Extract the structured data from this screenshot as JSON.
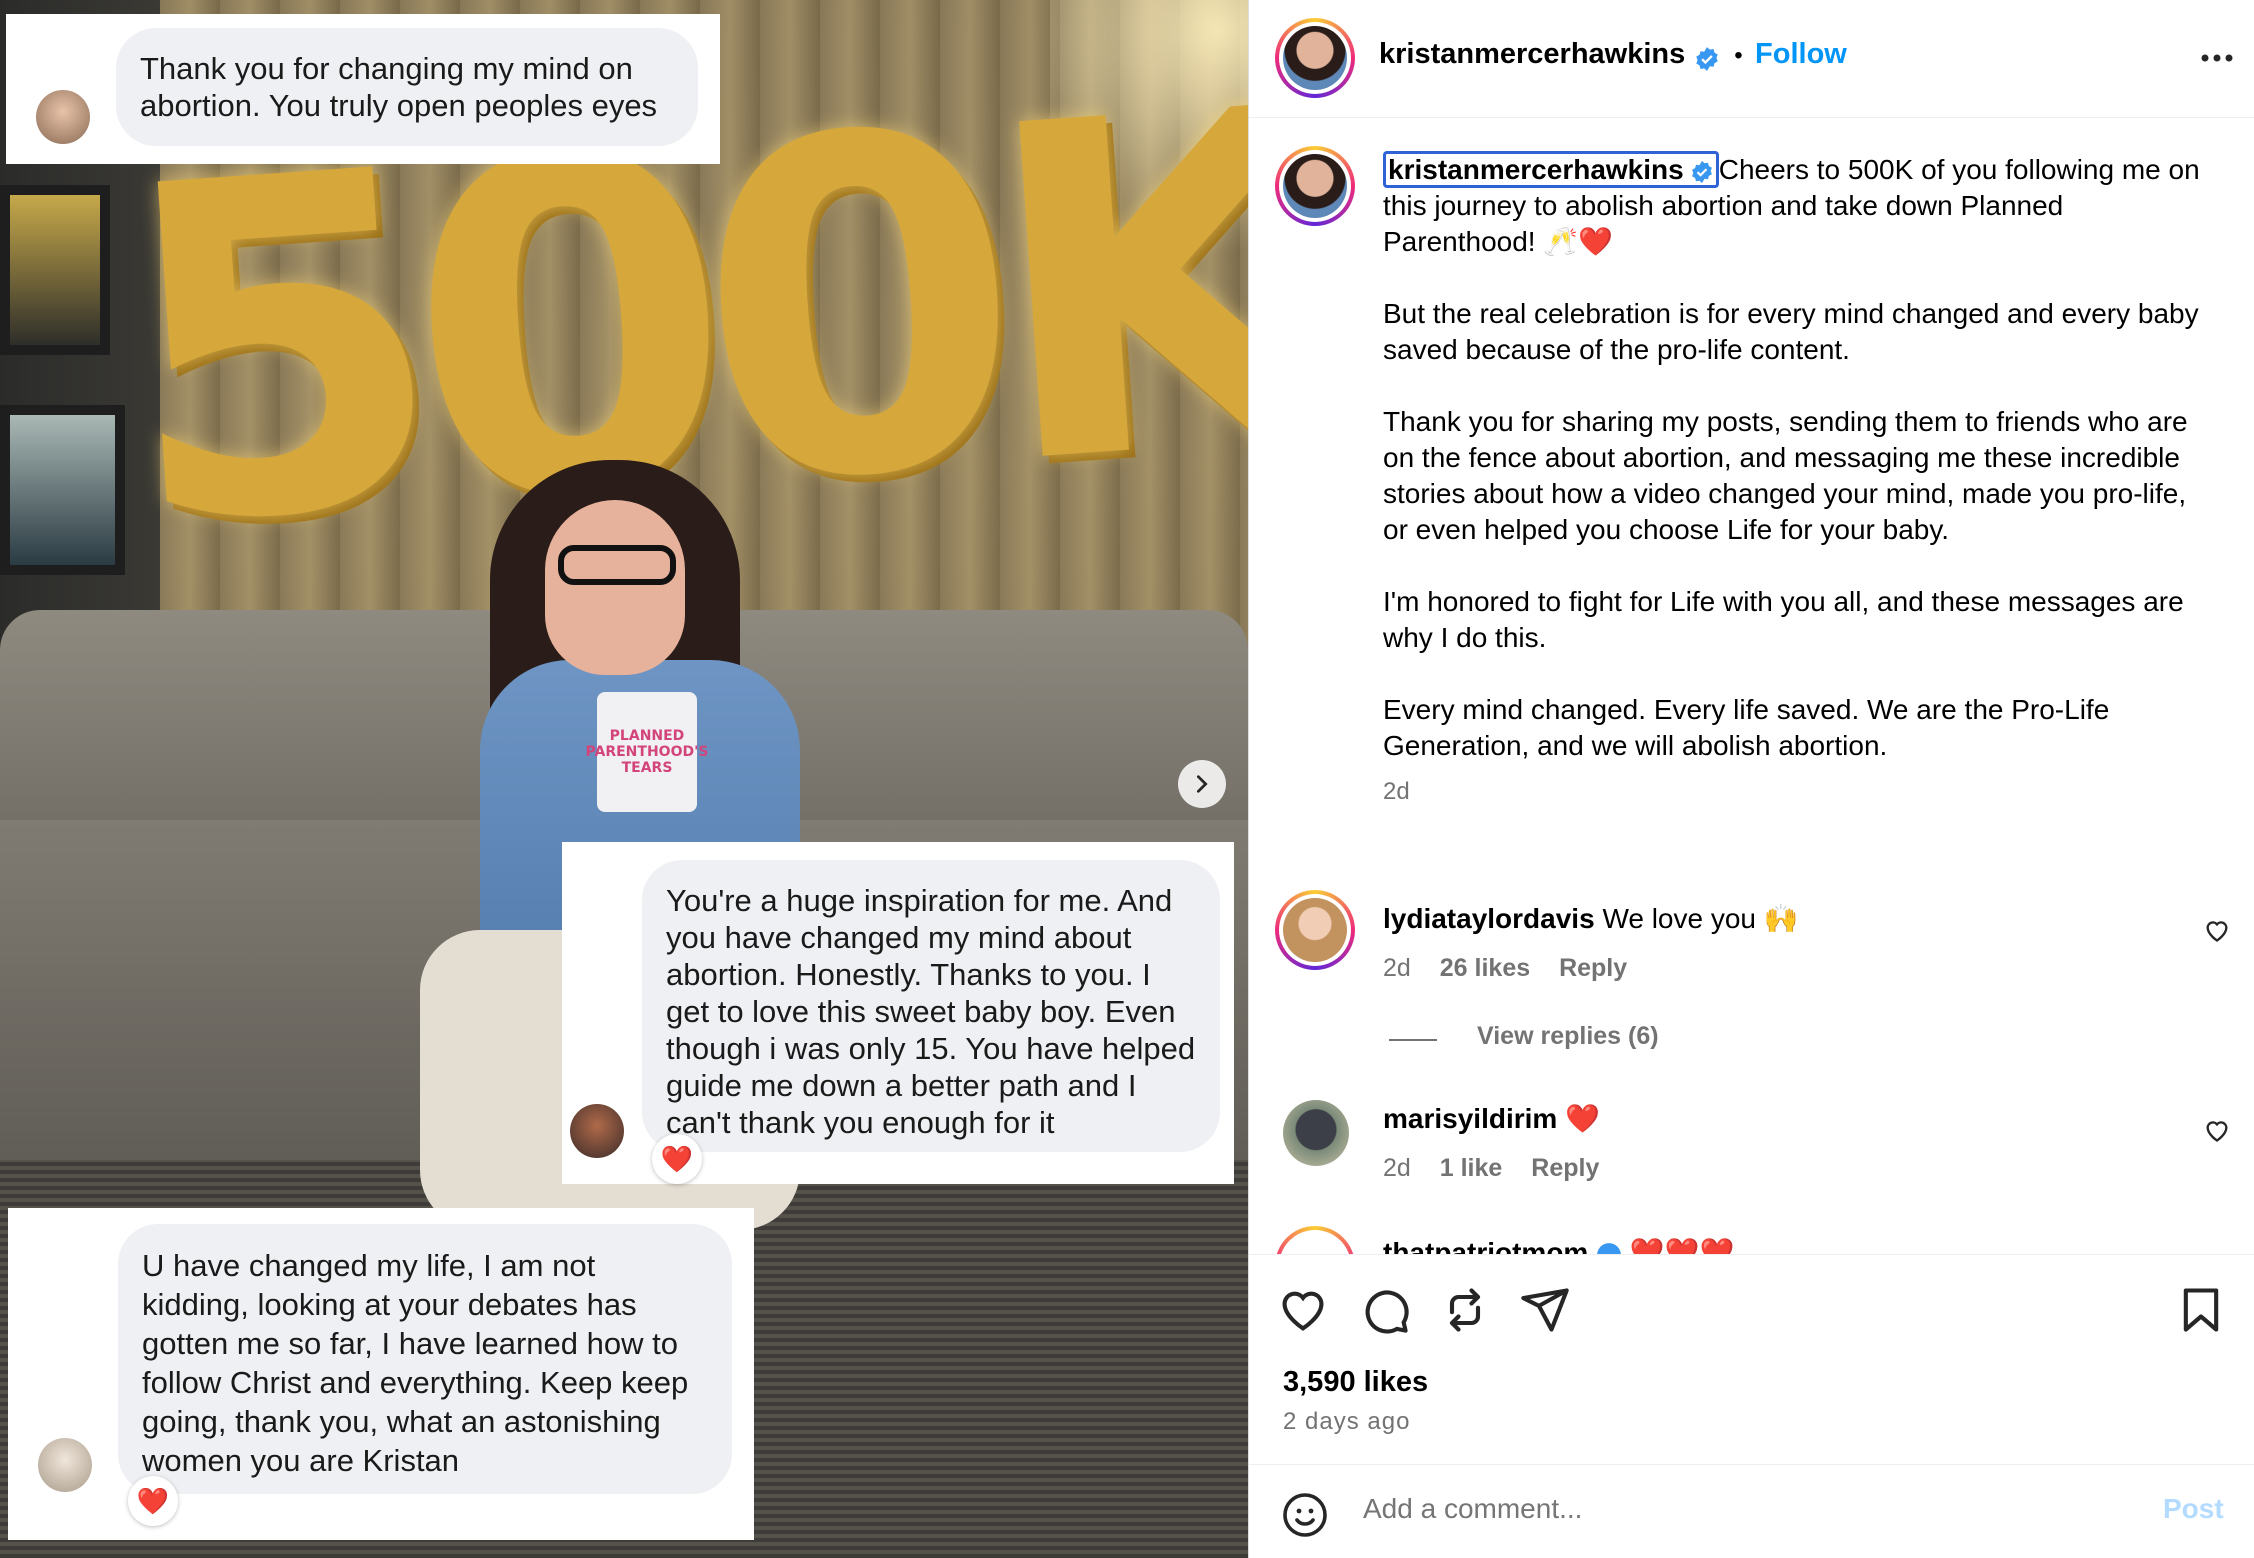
{
  "photo": {
    "balloon_text": "500K",
    "mug_text": "PLANNED PARENTHOOD'S TEARS",
    "messages": [
      {
        "text": "Thank you for changing my mind on abortion. You truly open peoples eyes"
      },
      {
        "text": "You're a huge inspiration for me. And you have changed my mind about abortion.  Honestly. Thanks to you. I get to love this sweet baby boy. Even though i was only 15. You have helped guide me down a better path and I can't thank you enough for it",
        "reaction": "❤️"
      },
      {
        "text": "U have changed my life, I am not kidding, looking at your debates has gotten me so far, I have learned how to follow Christ and everything. Keep keep going, thank you, what an astonishing women you are Kristan",
        "reaction": "❤️"
      }
    ]
  },
  "header": {
    "username": "kristanmercerhawkins",
    "separator": "•",
    "follow_label": "Follow",
    "more_icon": "more-horizontal-icon"
  },
  "caption": {
    "username": "kristanmercerhawkins",
    "para1": "Cheers to 500K of you following me on this journey to abolish abortion and take down Planned Parenthood! 🥂❤️",
    "para2": "But the real celebration is for every mind changed and every baby saved because of the pro-life content.",
    "para3": "Thank you for sharing my posts, sending them to friends who are on the fence about abortion, and messaging me these incredible stories about how a video changed your mind, made you pro-life, or even helped you choose Life for your baby.",
    "para4": "I'm honored to fight for Life with you all, and these messages are why I do this.",
    "para5": "Every mind changed. Every life saved. We are the Pro-Life Generation, and we will abolish abortion.",
    "time": "2d"
  },
  "comments": [
    {
      "username": "lydiataylordavis",
      "text": "We love you 🙌",
      "time": "2d",
      "likes": "26 likes",
      "reply": "Reply",
      "view_replies": "View replies (6)"
    },
    {
      "username": "marisyildirim",
      "text": "❤️",
      "time": "2d",
      "likes": "1 like",
      "reply": "Reply"
    },
    {
      "username": "thatpatriotmom",
      "text": "❤️❤️❤️"
    }
  ],
  "actions": {
    "likes": "3,590 likes",
    "posted": "2 days ago",
    "add_comment_placeholder": "Add a comment...",
    "post_label": "Post"
  },
  "colors": {
    "accent": "#0095f6",
    "verified": "#3897f0",
    "heart": "#ed4956"
  }
}
